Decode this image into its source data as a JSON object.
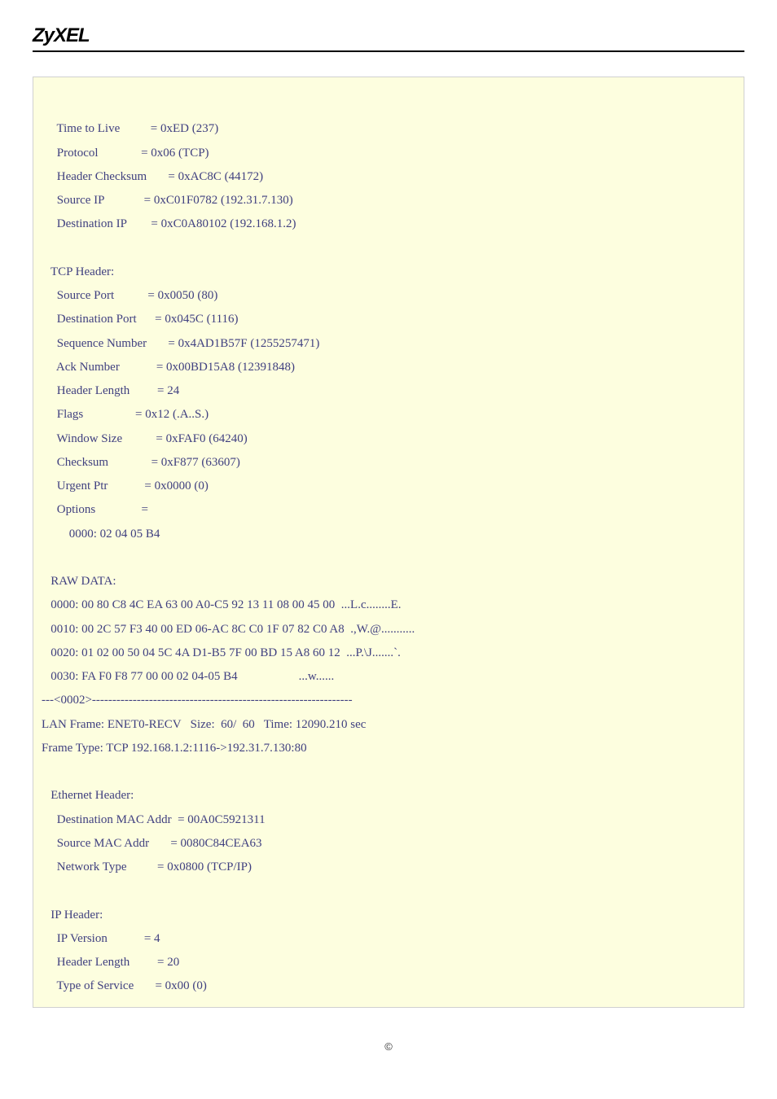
{
  "brand": "ZyXEL",
  "copyright": "©",
  "packet": {
    "ip1": {
      "ttl_label": "     Time to Live          = 0xED (237)",
      "proto_label": "     Protocol              = 0x06 (TCP)",
      "hcsum_label": "     Header Checksum       = 0xAC8C (44172)",
      "srcip_label": "     Source IP             = 0xC01F0782 (192.31.7.130)",
      "dstip_label": "     Destination IP        = 0xC0A80102 (192.168.1.2)"
    },
    "tcp": {
      "header": "   TCP Header:",
      "srcport": "     Source Port           = 0x0050 (80)",
      "dstport": "     Destination Port      = 0x045C (1116)",
      "seq": "     Sequence Number       = 0x4AD1B57F (1255257471)",
      "ack": "     Ack Number            = 0x00BD15A8 (12391848)",
      "hlen": "     Header Length         = 24",
      "flags": "     Flags                 = 0x12 (.A..S.)",
      "wsize": "     Window Size           = 0xFAF0 (64240)",
      "csum": "     Checksum              = 0xF877 (63607)",
      "urg": "     Urgent Ptr            = 0x0000 (0)",
      "opts": "     Options               =",
      "opts_bytes": "         0000: 02 04 05 B4"
    },
    "raw": {
      "header": "   RAW DATA:",
      "l0": "   0000: 00 80 C8 4C EA 63 00 A0-C5 92 13 11 08 00 45 00  ...L.c........E.",
      "l1": "   0010: 00 2C 57 F3 40 00 ED 06-AC 8C C0 1F 07 82 C0 A8  .,W.@...........",
      "l2": "   0020: 01 02 00 50 04 5C 4A D1-B5 7F 00 BD 15 A8 60 12  ...P.\\J.......`.",
      "l3": "   0030: FA F0 F8 77 00 00 02 04-05 B4                    ...w......"
    },
    "sep": "---<0002>----------------------------------------------------------------",
    "frame": {
      "l0": "LAN Frame: ENET0-RECV   Size:  60/  60   Time: 12090.210 sec",
      "l1": "Frame Type: TCP 192.168.1.2:1116->192.31.7.130:80"
    },
    "eth": {
      "header": "   Ethernet Header:",
      "dstmac": "     Destination MAC Addr  = 00A0C5921311",
      "srcmac": "     Source MAC Addr       = 0080C84CEA63",
      "ntype": "     Network Type          = 0x0800 (TCP/IP)"
    },
    "ip2": {
      "header": "   IP Header:",
      "ver": "     IP Version            = 4",
      "hlen": "     Header Length         = 20",
      "tos": "     Type of Service       = 0x00 (0)"
    }
  }
}
